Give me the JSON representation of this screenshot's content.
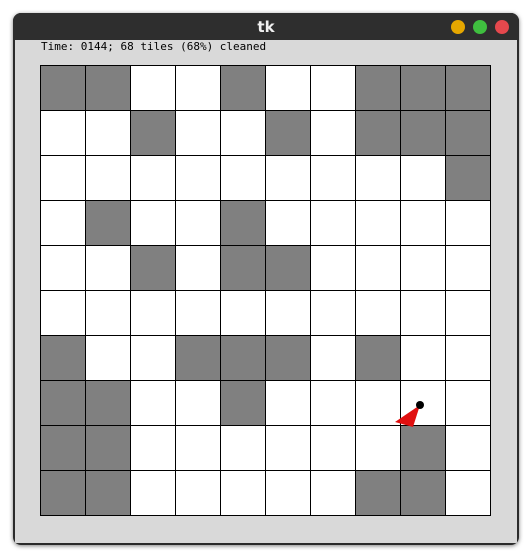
{
  "window": {
    "title": "tk"
  },
  "status_text": "Time: 0144; 68 tiles (68%) cleaned",
  "grid": {
    "rows": 10,
    "cols": 10,
    "dirty_color": "#808080",
    "clean_color": "#ffffff",
    "dirty_cells": [
      [
        0,
        0
      ],
      [
        0,
        1
      ],
      [
        0,
        4
      ],
      [
        0,
        7
      ],
      [
        0,
        8
      ],
      [
        0,
        9
      ],
      [
        1,
        2
      ],
      [
        1,
        5
      ],
      [
        1,
        7
      ],
      [
        1,
        8
      ],
      [
        1,
        9
      ],
      [
        2,
        9
      ],
      [
        3,
        1
      ],
      [
        3,
        4
      ],
      [
        4,
        2
      ],
      [
        4,
        4
      ],
      [
        4,
        5
      ],
      [
        6,
        0
      ],
      [
        6,
        3
      ],
      [
        6,
        4
      ],
      [
        6,
        5
      ],
      [
        6,
        7
      ],
      [
        7,
        0
      ],
      [
        7,
        1
      ],
      [
        7,
        4
      ],
      [
        8,
        0
      ],
      [
        8,
        1
      ],
      [
        8,
        8
      ],
      [
        9,
        0
      ],
      [
        9,
        1
      ],
      [
        9,
        7
      ],
      [
        9,
        8
      ]
    ]
  },
  "robot": {
    "color": "#e01010",
    "pivot_color": "#000000"
  }
}
